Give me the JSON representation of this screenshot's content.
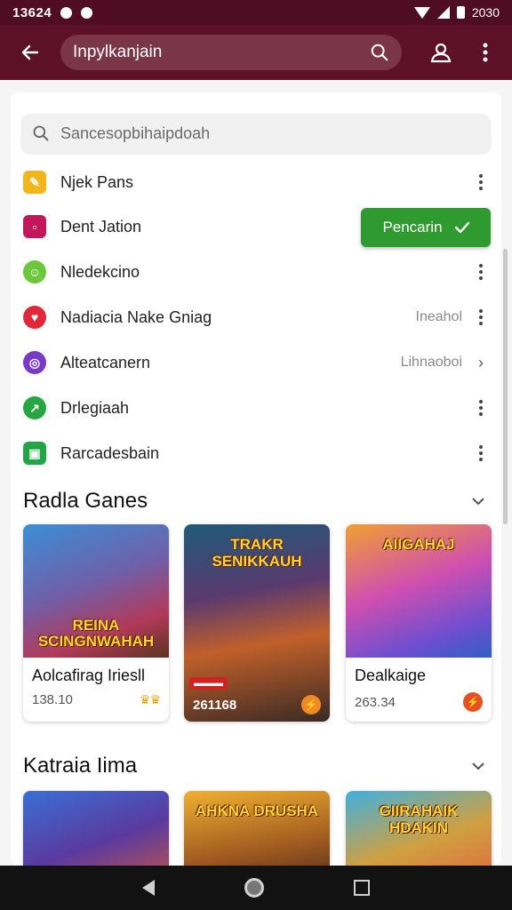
{
  "status_bar": {
    "time": "13624",
    "right_text": "2030"
  },
  "app_bar": {
    "search_value": "Inpylkanjain"
  },
  "inner_search": {
    "placeholder": "Sancesopbihaipdoah"
  },
  "list": [
    {
      "label": "Njek Pans",
      "icon": "pencil-icon",
      "color": "#f2b51b",
      "meta": "",
      "trailing": "kebab"
    },
    {
      "label": "Dent Jation",
      "icon": "box-icon",
      "color": "#c2185b",
      "meta": "",
      "trailing": "none"
    },
    {
      "label": "Nledekcino",
      "icon": "smile-icon",
      "color": "#6cc73b",
      "meta": "",
      "trailing": "kebab"
    },
    {
      "label": "Nadiacia Nake Gniag",
      "icon": "heart-icon",
      "color": "#e0283a",
      "meta": "Ineahol",
      "trailing": "kebab"
    },
    {
      "label": "Alteatcanern",
      "icon": "globe-icon",
      "color": "#7a3ac9",
      "meta": "Lihnaoboi",
      "trailing": "chevron"
    },
    {
      "label": "Drlegiaah",
      "icon": "chart-icon",
      "color": "#26a641",
      "meta": "",
      "trailing": "kebab"
    },
    {
      "label": "Rarcadesbain",
      "icon": "bag-icon",
      "color": "#22a545",
      "meta": "",
      "trailing": "kebab"
    }
  ],
  "confirm_button": {
    "label": "Pencarin"
  },
  "section1": {
    "title": "Radla Ganes",
    "cards": [
      {
        "art_text": "REINA SCINGNWAHAH",
        "title": "Aolcafirag Iriesll",
        "meta": "138.10",
        "badge": "crowns"
      },
      {
        "art_text": "TRAKR SENIKKAUH",
        "title": "",
        "meta": "261168",
        "badge": "orange"
      },
      {
        "art_text": "AIIGAHAJ",
        "title": "Dealkaige",
        "meta": "263.34",
        "badge": "orange"
      }
    ]
  },
  "section2": {
    "title": "Katraia Iima",
    "cards": [
      {
        "art_text": ""
      },
      {
        "art_text": "AHKNA DRUSHA"
      },
      {
        "art_text": "GIIRAHAIK HDAKIN"
      }
    ]
  },
  "colors": {
    "appbar": "#5c1129",
    "statusbar": "#4e0d22",
    "accent_green": "#2f9a2f"
  }
}
